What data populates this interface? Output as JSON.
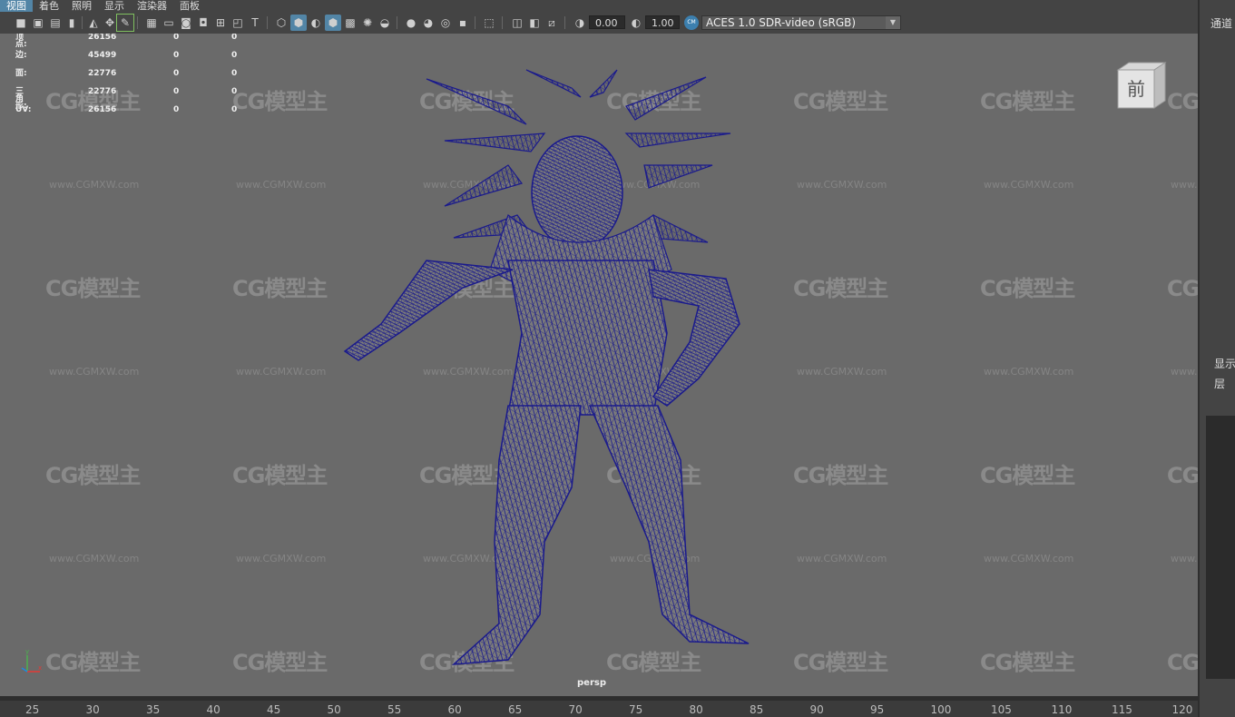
{
  "menu": [
    "视图",
    "着色",
    "照明",
    "显示",
    "渲染器",
    "面板"
  ],
  "toolbar": {
    "exposure_value": "0.00",
    "gamma_value": "1.00",
    "color_space": "ACES 1.0 SDR-video (sRGB)"
  },
  "hud": {
    "rows": [
      {
        "label": "顶点:",
        "v1": "26156",
        "v2": "0",
        "v3": "0"
      },
      {
        "label": "边:",
        "v1": "45499",
        "v2": "0",
        "v3": "0"
      },
      {
        "label": "面:",
        "v1": "22776",
        "v2": "0",
        "v3": "0"
      },
      {
        "label": "三角形:",
        "v1": "22776",
        "v2": "0",
        "v3": "0"
      },
      {
        "label": "UV:",
        "v1": "26156",
        "v2": "0",
        "v3": "0"
      }
    ]
  },
  "viewcube_label": "前",
  "camera_label": "persp",
  "watermark": {
    "logo": "CG模型主",
    "url": "www.CGMXW.com"
  },
  "right_panel": {
    "channel_label": "通道",
    "display_label": "显示",
    "layer_label": "层"
  },
  "timeline_ticks": [
    "25",
    "30",
    "35",
    "40",
    "45",
    "50",
    "55",
    "60",
    "65",
    "70",
    "75",
    "80",
    "85",
    "90",
    "95",
    "100",
    "105",
    "110",
    "115",
    "120"
  ],
  "colors": {
    "viewport_bg": "#6a6a6a",
    "wire": "#1a1a8c",
    "accent": "#5285a6"
  }
}
